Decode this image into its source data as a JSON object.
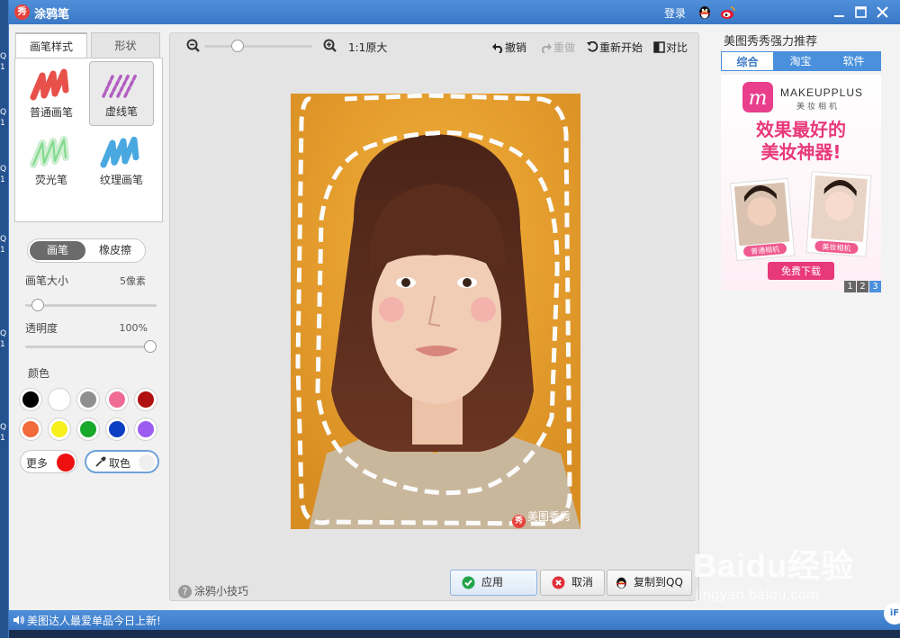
{
  "desktop": {
    "strip_letters": [
      "Q",
      "1",
      "Q",
      "1",
      "Q",
      "1",
      "Q",
      "1",
      "Q",
      "1",
      "Q",
      "1"
    ]
  },
  "titlebar": {
    "logo": "秀",
    "title": "涂鸦笔",
    "login": "登录"
  },
  "left": {
    "tabs": [
      "画笔样式",
      "形状"
    ],
    "brushes": [
      {
        "label": "普通画笔",
        "color": "#e8504a"
      },
      {
        "label": "虚线笔",
        "color": "#b25ec2"
      },
      {
        "label": "荧光笔",
        "color": "#7ed98a"
      },
      {
        "label": "纹理画笔",
        "color": "#4aa8e0"
      }
    ],
    "mode_on": "画笔",
    "mode_off": "橡皮擦",
    "size_label": "画笔大小",
    "size_value": "5像素",
    "size_fraction": 0.05,
    "opacity_label": "透明度",
    "opacity_value": "100%",
    "opacity_fraction": 1.0,
    "color_label": "颜色",
    "colors": [
      "#000000",
      "#ffffff",
      "#8f8f8f",
      "#f06b95",
      "#b01010",
      "#f06a3a",
      "#f7f01c",
      "#18a82a",
      "#0c3ec4",
      "#9b5cf0"
    ],
    "more_label": "更多",
    "more_color": "#ee1111",
    "pick_label": "取色"
  },
  "center": {
    "ratio_label": "1:1原大",
    "zoom_fraction": 0.28,
    "undo": "撤销",
    "redo": "重做",
    "restart": "重新开始",
    "compare": "对比",
    "watermark": "美图秀秀",
    "tips": "涂鸦小技巧",
    "apply": "应用",
    "cancel": "取消",
    "copy_qq": "复制到QQ"
  },
  "right": {
    "title": "美图秀秀强力推荐",
    "tabs": [
      "综合",
      "淘宝",
      "软件"
    ],
    "ad": {
      "brand": "MAKEUPPLUS",
      "brand_cn": "美妆相机",
      "slogan1": "效果最好的",
      "slogan2": "美妆神器!",
      "card1": "普通相机",
      "card2": "美妆相机",
      "download": "免费下载"
    },
    "pages": [
      "1",
      "2",
      "3"
    ]
  },
  "status": {
    "text": "美图达人最爱单品今日上新!"
  },
  "watermark_site": {
    "logo": "Baidu经验",
    "url": "jingyan.baidu.com",
    "badge": "iF"
  }
}
